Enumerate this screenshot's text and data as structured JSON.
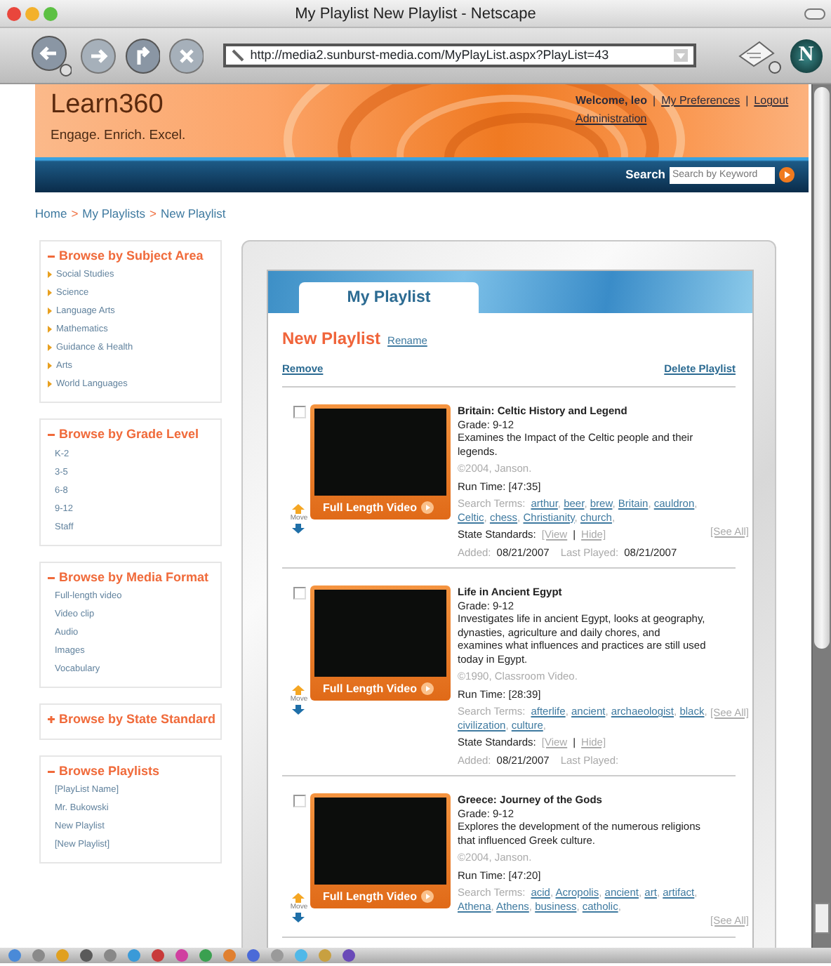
{
  "window": {
    "title": "My Playlist New Playlist - Netscape"
  },
  "toolbar": {
    "address": "http://media2.sunburst-media.com/MyPlayList.aspx?PlayList=43",
    "logo_letter": "N"
  },
  "header": {
    "logo": "Learn360",
    "tagline": "Engage. Enrich. Excel.",
    "welcome": "Welcome, leo",
    "separator": "|",
    "links": [
      "My Preferences",
      "Logout"
    ],
    "admin_link": "Administration"
  },
  "search": {
    "label": "Search",
    "placeholder": "Search by Keyword"
  },
  "breadcrumb": {
    "separator": ">",
    "items": [
      "Home",
      "My Playlists",
      "New Playlist"
    ]
  },
  "sidebar": [
    {
      "title": "Browse by Subject Area",
      "expanded": true,
      "kind": "bulleted",
      "items": [
        "Social Studies",
        "Science",
        "Language Arts",
        "Mathematics",
        "Guidance & Health",
        "Arts",
        "World Languages"
      ]
    },
    {
      "title": "Browse by Grade Level",
      "expanded": true,
      "kind": "plain",
      "items": [
        "K-2",
        "3-5",
        "6-8",
        "9-12",
        "Staff"
      ]
    },
    {
      "title": "Browse by Media Format",
      "expanded": true,
      "kind": "plain",
      "items": [
        "Full-length video",
        "Video clip",
        "Audio",
        "Images",
        "Vocabulary"
      ]
    },
    {
      "title": "Browse by State Standard",
      "expanded": false
    },
    {
      "title": "Browse Playlists",
      "expanded": true,
      "kind": "plain",
      "items": [
        "[PlayList Name]",
        "Mr. Bukowski",
        "New Playlist",
        "[New Playlist]"
      ]
    }
  ],
  "panel": {
    "tab": "My Playlist",
    "title": "New Playlist",
    "rename": "Rename",
    "remove": "Remove",
    "delete": "Delete Playlist",
    "term_separator": ","
  },
  "items": [
    {
      "checked": false,
      "move": "Move",
      "video_button": "Full Length Video",
      "title": "Britain: Celtic History and Legend",
      "grade": "Grade: 9-12",
      "description": "Examines the Impact of the Celtic people and their legends.",
      "copyright": "©2004, Janson.",
      "run_time": "Run Time: [47:35]",
      "terms_label": "Search Terms:",
      "terms": [
        "arthur",
        "beer",
        "brew",
        "Britain",
        "cauldron",
        "Celtic",
        "chess",
        "Christianity",
        "church"
      ],
      "see_all": "[See All]",
      "standards_label": "State Standards:",
      "standards": [
        "[View",
        "|",
        "Hide]"
      ],
      "added_label": "Added:",
      "added": "08/21/2007",
      "played_label": "Last Played:",
      "played": "08/21/2007"
    },
    {
      "checked": false,
      "move": "Move",
      "video_button": "Full Length Video",
      "title": "Life in Ancient Egypt",
      "grade": "Grade: 9-12",
      "description": "Investigates life in ancient Egypt, looks at geography, dynasties, agriculture and daily chores, and examines what influences and practices are still used today in Egypt.",
      "copyright": "©1990, Classroom Video.",
      "run_time": "Run Time: [28:39]",
      "terms_label": "Search Terms:",
      "terms": [
        "afterlife",
        "ancient",
        "archaeologist",
        "black",
        "civilization",
        "culture"
      ],
      "see_all": "[See All]",
      "standards_label": "State Standards:",
      "standards": [
        "[View",
        "|",
        "Hide]"
      ],
      "added_label": "Added:",
      "added": "08/21/2007",
      "played_label": "Last Played:"
    },
    {
      "checked": false,
      "move": "Move",
      "video_button": "Full Length Video",
      "title": "Greece: Journey of the Gods",
      "grade": "Grade: 9-12",
      "description": "Explores the development of the numerous religions that influenced Greek culture.",
      "copyright": "©2004, Janson.",
      "run_time": "Run Time: [47:20]",
      "terms_label": "Search Terms:",
      "terms": [
        "acid",
        "Acropolis",
        "ancient",
        "art",
        "artifact",
        "Athena",
        "Athens",
        "business",
        "catholic"
      ],
      "see_all": "[See All]"
    }
  ]
}
